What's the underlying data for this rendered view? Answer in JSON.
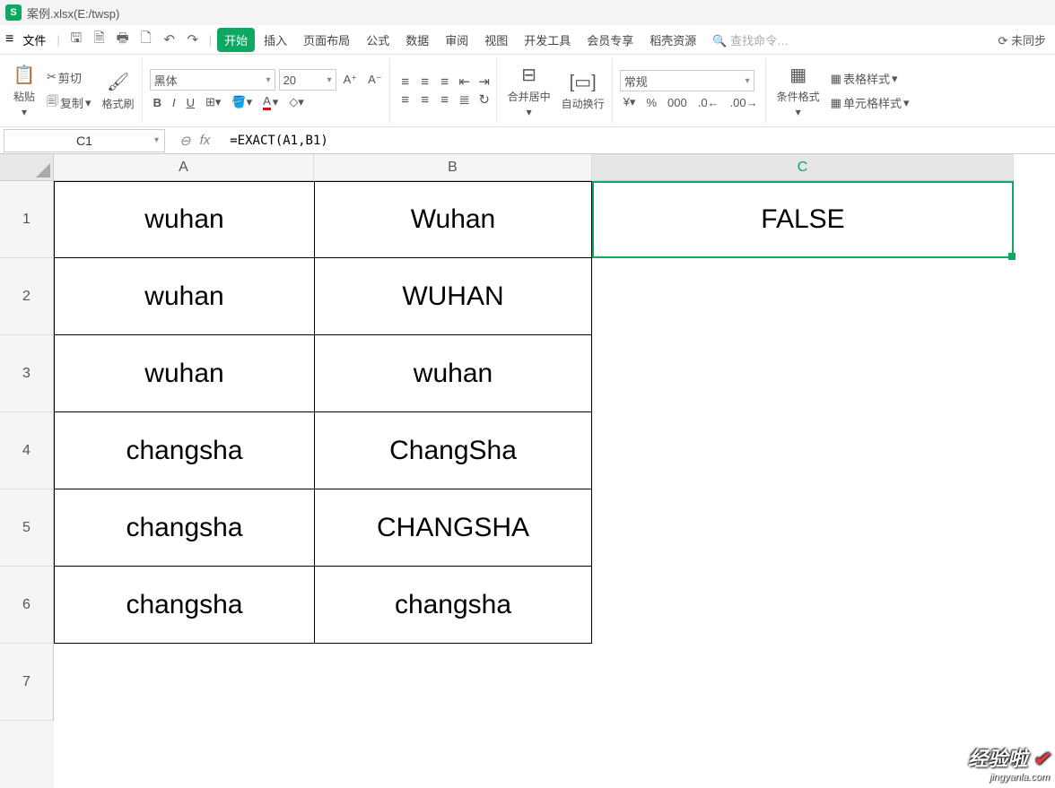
{
  "title": "案例.xlsx(E:/twsp)",
  "app_icon": "S",
  "menubar": {
    "file": "文件",
    "tabs": [
      "开始",
      "插入",
      "页面布局",
      "公式",
      "数据",
      "审阅",
      "视图",
      "开发工具",
      "会员专享",
      "稻壳资源"
    ],
    "search_placeholder": "查找命令…",
    "sync": "未同步"
  },
  "ribbon": {
    "paste": "粘贴",
    "cut": "剪切",
    "copy": "复制",
    "format_painter": "格式刷",
    "font_name": "黑体",
    "font_size": "20",
    "bold": "B",
    "italic": "I",
    "underline": "U",
    "merge_center": "合并居中",
    "auto_wrap": "自动换行",
    "num_format": "常规",
    "cond_fmt": "条件格式",
    "table_style": "表格样式",
    "cell_style": "单元格样式"
  },
  "formula_bar": {
    "name_box": "C1",
    "formula": "=EXACT(A1,B1)"
  },
  "columns": [
    "A",
    "B",
    "C"
  ],
  "rows": [
    "1",
    "2",
    "3",
    "4",
    "5",
    "6",
    "7"
  ],
  "cells": [
    {
      "A": "wuhan",
      "B": "Wuhan",
      "C": "FALSE"
    },
    {
      "A": "wuhan",
      "B": "WUHAN",
      "C": ""
    },
    {
      "A": "wuhan",
      "B": "wuhan",
      "C": ""
    },
    {
      "A": "changsha",
      "B": "ChangSha",
      "C": ""
    },
    {
      "A": "changsha",
      "B": "CHANGSHA",
      "C": ""
    },
    {
      "A": "changsha",
      "B": "changsha",
      "C": ""
    },
    {
      "A": "",
      "B": "",
      "C": ""
    }
  ],
  "watermark": {
    "line1": "经验啦",
    "check": "✔",
    "line2": "jingyanla.com"
  }
}
